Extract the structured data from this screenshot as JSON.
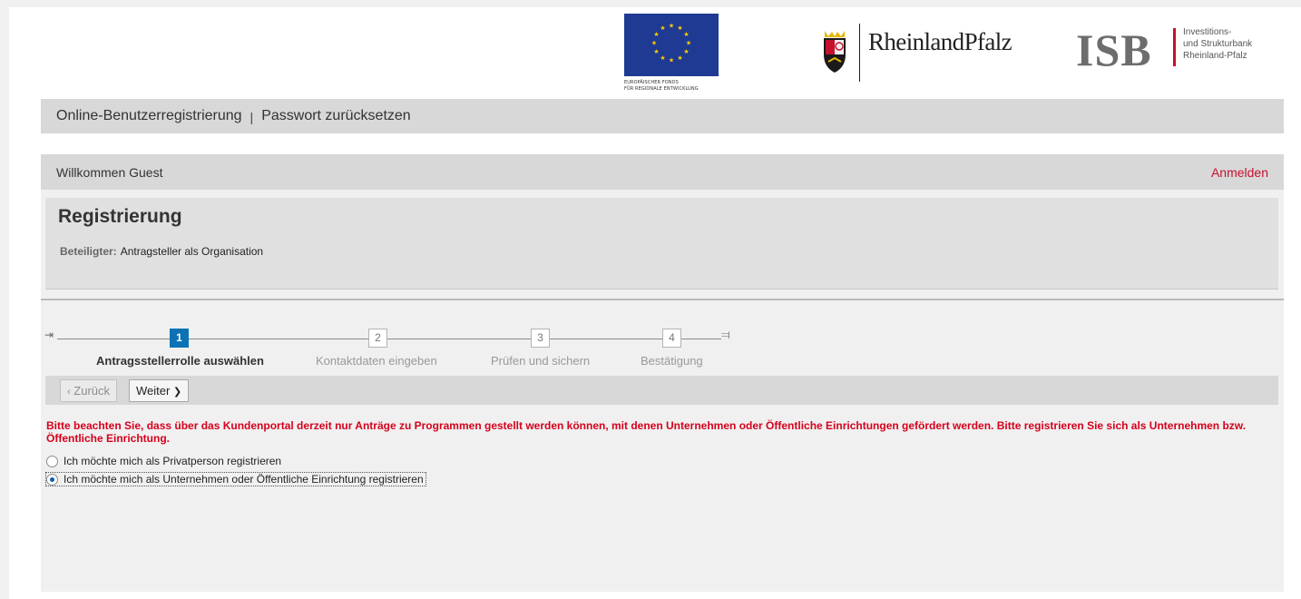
{
  "logos": {
    "eu_caption_line1": "EUROPÄISCHER FONDS",
    "eu_caption_line2": "FÜR REGIONALE ENTWICKLUNG",
    "rlp_text": "RheinlandPfalz",
    "isb_text": "ISB",
    "isb_sub_line1": "Investitions-",
    "isb_sub_line2": "und Strukturbank",
    "isb_sub_line3": "Rheinland-Pfalz"
  },
  "nav": {
    "items": [
      "Online-Benutzerregistrierung",
      "Passwort zurücksetzen"
    ],
    "separator": "|"
  },
  "welcome": {
    "text": "Willkommen Guest",
    "login_label": "Anmelden"
  },
  "registration": {
    "title": "Registrierung",
    "meta_key": "Beteiligter:",
    "meta_value": "Antragsteller als Organisation"
  },
  "roadmap": {
    "steps": [
      {
        "number": "1",
        "label": "Antragsstellerrolle auswählen",
        "active": true
      },
      {
        "number": "2",
        "label": "Kontaktdaten eingeben",
        "active": false
      },
      {
        "number": "3",
        "label": "Prüfen und sichern",
        "active": false
      },
      {
        "number": "4",
        "label": "Bestätigung",
        "active": false
      }
    ]
  },
  "toolbar": {
    "back_label": "Zurück",
    "next_label": "Weiter"
  },
  "notice": "Bitte beachten Sie, dass über das Kundenportal derzeit nur Anträge zu Programmen gestellt werden können, mit denen Unternehmen oder Öffentliche Einrichtungen gefördert werden. Bitte registrieren Sie sich als Unternehmen bzw. Öffentliche Einrichtung.",
  "options": [
    {
      "label": "Ich möchte mich als Privatperson registrieren",
      "selected": false
    },
    {
      "label": "Ich möchte mich als Unternehmen oder Öffentliche Einrichtung registrieren",
      "selected": true
    }
  ],
  "colors": {
    "accent_red": "#c4122f",
    "notice_red": "#d6001c",
    "step_active_blue": "#0a72b5",
    "eu_blue": "#1f3a93",
    "eu_star_yellow": "#ffcc00"
  }
}
